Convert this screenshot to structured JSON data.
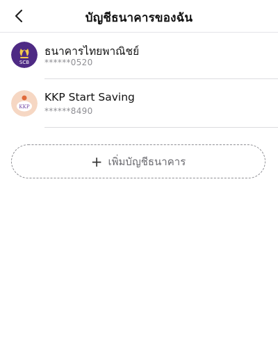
{
  "header": {
    "title": "บัญชีธนาคารของฉัน"
  },
  "accounts": [
    {
      "bank_name": "ธนาคารไทยพาณิชย์",
      "account_masked": "******0520",
      "logo_text": "SCB",
      "logo_color": "#4e2a84"
    },
    {
      "bank_name": "KKP Start Saving",
      "account_masked": "******8490",
      "logo_text": "KKP",
      "logo_color": "#f6d7c3"
    }
  ],
  "add_button": {
    "label": "เพิ่มบัญชีธนาคาร",
    "icon": "plus-icon"
  },
  "colors": {
    "divider": "#dcdcdf",
    "muted_text": "#8e8e93",
    "dashed_border": "#8e8e93"
  }
}
